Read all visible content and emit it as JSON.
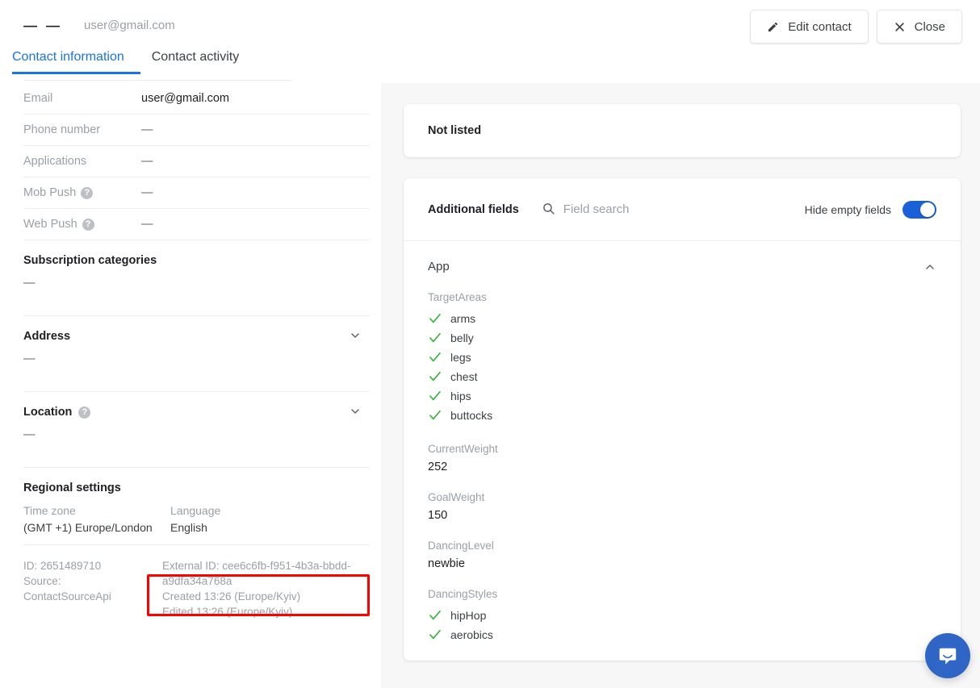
{
  "header": {
    "first_name_placeholder": "—",
    "last_name_placeholder": "—",
    "email": "user@gmail.com",
    "edit_button": "Edit contact",
    "close_button": "Close"
  },
  "tabs": [
    {
      "label": "Contact information",
      "active": true
    },
    {
      "label": "Contact activity",
      "active": false
    }
  ],
  "contact_fields": [
    {
      "label": "Email",
      "value": "user@gmail.com",
      "help": false
    },
    {
      "label": "Phone number",
      "value": "—",
      "help": false
    },
    {
      "label": "Applications",
      "value": "—",
      "help": false
    },
    {
      "label": "Mob Push",
      "value": "—",
      "help": true
    },
    {
      "label": "Web Push",
      "value": "—",
      "help": true
    }
  ],
  "blocks": [
    {
      "title": "Subscription categories",
      "value": "—",
      "collapsible": false
    },
    {
      "title": "Address",
      "value": "—",
      "collapsible": true,
      "help": false
    },
    {
      "title": "Location",
      "value": "—",
      "collapsible": true,
      "help": true
    }
  ],
  "regional": {
    "title": "Regional settings",
    "timezone_label": "Time zone",
    "timezone_value": "(GMT +1) Europe/London",
    "language_label": "Language",
    "language_value": "English"
  },
  "identifiers": {
    "id": "ID: 2651489710",
    "source_label": "Source:",
    "source_value": "ContactSourceApi",
    "external_id": "External ID: cee6c6fb-f951-4b3a-bbdd-a9dfa34a768a",
    "created": "Created 13:26 (Europe/Kyiv)",
    "edited": "Edited 13:26 (Europe/Kyiv)",
    "highlight_color": "#ff0000"
  },
  "right_panel": {
    "not_listed": "Not listed",
    "additional_fields_title": "Additional fields",
    "search_placeholder": "Field search",
    "search_value": "",
    "hide_empty_label": "Hide empty fields",
    "hide_empty_on": true,
    "toggle_color": "#1a61d9",
    "group": {
      "name": "App",
      "expanded": true,
      "fields": [
        {
          "name": "TargetAreas",
          "type": "checklist",
          "items": [
            "arms",
            "belly",
            "legs",
            "chest",
            "hips",
            "buttocks"
          ]
        },
        {
          "name": "CurrentWeight",
          "type": "text",
          "value": "252"
        },
        {
          "name": "GoalWeight",
          "type": "text",
          "value": "150"
        },
        {
          "name": "DancingLevel",
          "type": "text",
          "value": "newbie"
        },
        {
          "name": "DancingStyles",
          "type": "checklist",
          "items": [
            "hipHop",
            "aerobics"
          ]
        }
      ]
    }
  },
  "colors": {
    "accent": "#1a73e8",
    "check_green": "#34b233",
    "label_gray": "#9aa0a6",
    "panel_bg": "#f7f7f8"
  },
  "intercom": {
    "label": "chat-bubble"
  }
}
